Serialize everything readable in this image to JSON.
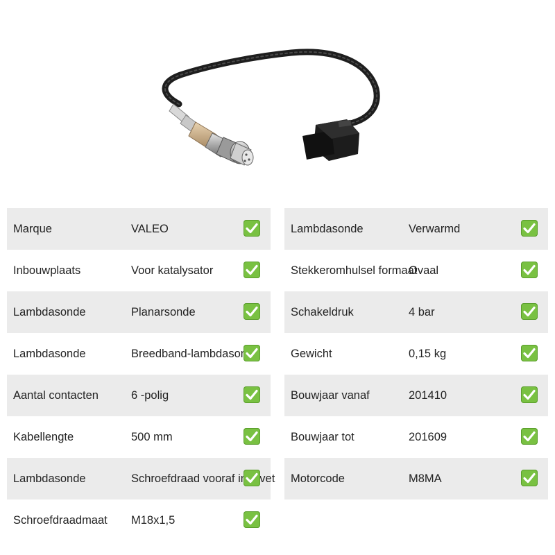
{
  "product": {
    "image_alt": "Lambdasonde met kabel en stekker",
    "colors": {
      "row_shade": "#ebebeb",
      "check": "#79c142"
    },
    "icon": "check-icon"
  },
  "specs_left": [
    {
      "label": "Marque",
      "value": "VALEO"
    },
    {
      "label": "Inbouwplaats",
      "value": "Voor katalysator"
    },
    {
      "label": "Lambdasonde",
      "value": "Planarsonde"
    },
    {
      "label": "Lambdasonde",
      "value": "Breedband-lambdasonde"
    },
    {
      "label": "Aantal contacten",
      "value": "6 -polig"
    },
    {
      "label": "Kabellengte",
      "value": "500 mm"
    },
    {
      "label": "Lambdasonde",
      "value": "Schroefdraad vooraf ingevet"
    },
    {
      "label": "Schroefdraadmaat",
      "value": "M18x1,5"
    }
  ],
  "specs_right": [
    {
      "label": "Lambdasonde",
      "value": "Verwarmd"
    },
    {
      "label": "Stekkeromhulsel formaat",
      "value": "Ovaal"
    },
    {
      "label": "Schakeldruk",
      "value": "4 bar"
    },
    {
      "label": "Gewicht",
      "value": "0,15 kg"
    },
    {
      "label": "Bouwjaar vanaf",
      "value": "201410"
    },
    {
      "label": "Bouwjaar tot",
      "value": "201609"
    },
    {
      "label": "Motorcode",
      "value": "M8MA"
    }
  ]
}
